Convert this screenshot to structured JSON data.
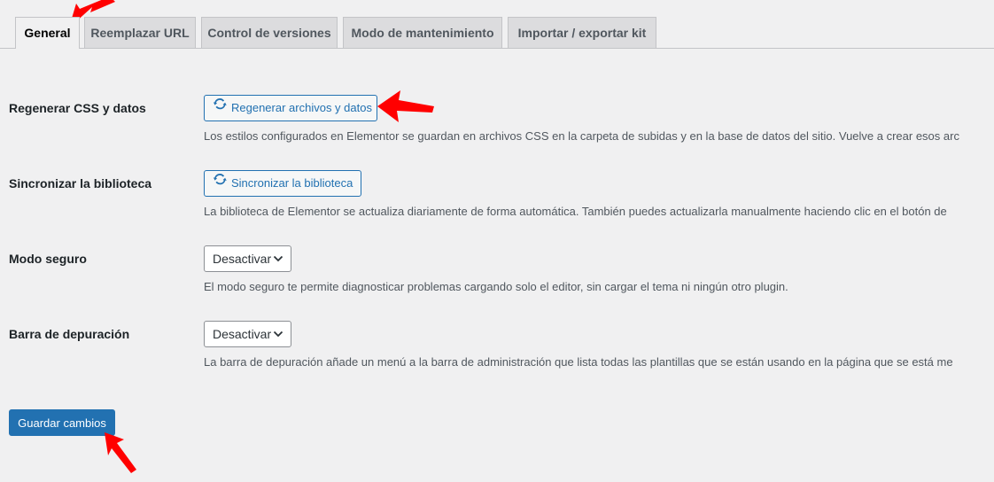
{
  "tabs": [
    {
      "label": "General",
      "active": true
    },
    {
      "label": "Reemplazar URL"
    },
    {
      "label": "Control de versiones"
    },
    {
      "label": "Modo de mantenimiento"
    },
    {
      "label": "Importar / exportar kit"
    }
  ],
  "settings": {
    "regen": {
      "label": "Regenerar CSS y datos",
      "button": "Regenerar archivos y datos",
      "description": "Los estilos configurados en Elementor se guardan en archivos CSS en la carpeta de subidas y en la base de datos del sitio. Vuelve a crear esos arc"
    },
    "sync": {
      "label": "Sincronizar la biblioteca",
      "button": "Sincronizar la biblioteca",
      "description": "La biblioteca de Elementor se actualiza diariamente de forma automática. También puedes actualizarla manualmente haciendo clic en el botón de"
    },
    "safe_mode": {
      "label": "Modo seguro",
      "value": "Desactivar",
      "description": "El modo seguro te permite diagnosticar problemas cargando solo el editor, sin cargar el tema ni ningún otro plugin."
    },
    "debug_bar": {
      "label": "Barra de depuración",
      "value": "Desactivar",
      "description": "La barra de depuración añade un menú a la barra de administración que lista todas las plantillas que se están usando en la página que se está me"
    }
  },
  "save_button": "Guardar cambios",
  "colors": {
    "accent": "#2271b1",
    "annotation_arrow": "#ff0000"
  },
  "icons": {
    "sync": "refresh-icon",
    "select": "chevron-down-icon"
  }
}
